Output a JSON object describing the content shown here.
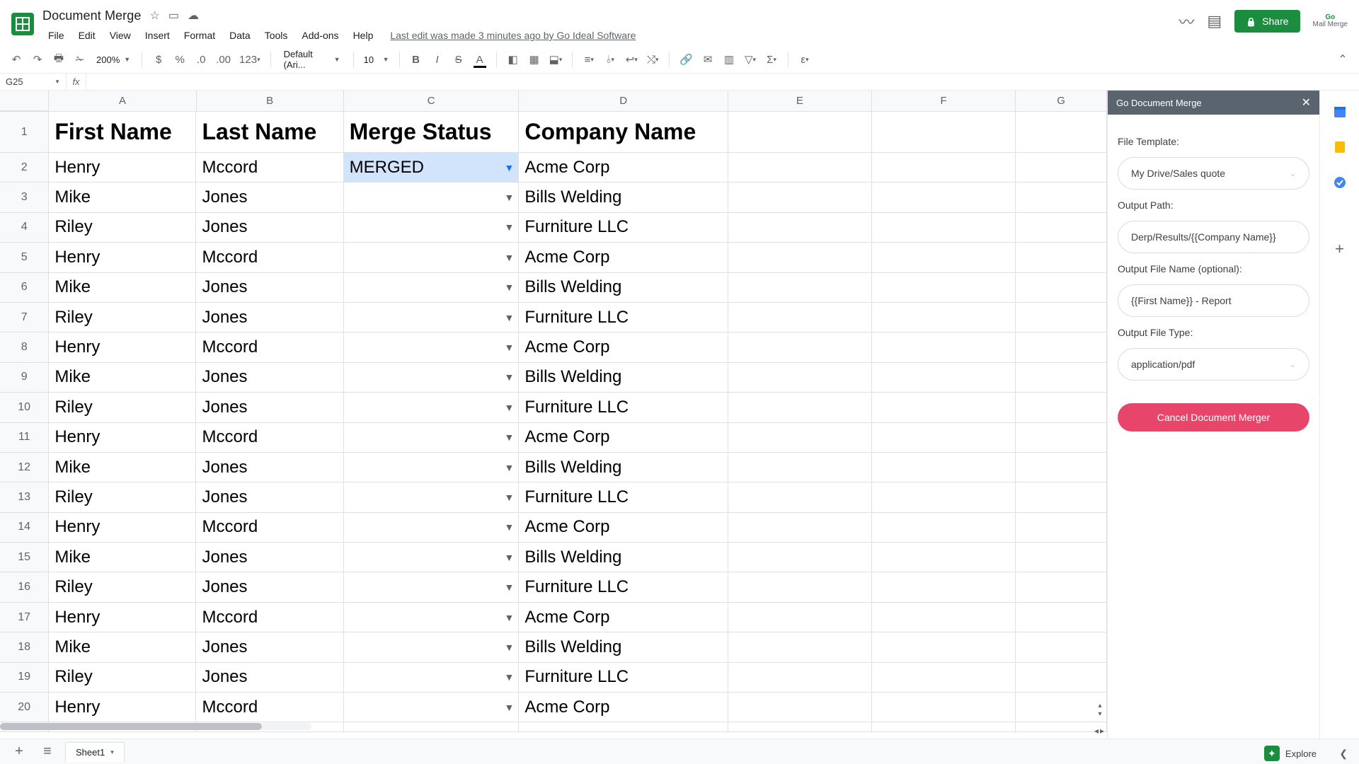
{
  "doc": {
    "title": "Document Merge"
  },
  "menus": [
    "File",
    "Edit",
    "View",
    "Insert",
    "Format",
    "Data",
    "Tools",
    "Add-ons",
    "Help"
  ],
  "last_edit": "Last edit was made 3 minutes ago by Go Ideal Software",
  "share_label": "Share",
  "ext_logo": {
    "top": "Go",
    "bottom": "Mail Merge"
  },
  "toolbar": {
    "zoom": "200%",
    "font_name": "Default (Ari...",
    "font_size": "10",
    "number_fmt": "123"
  },
  "name_box": "G25",
  "columns": [
    "A",
    "B",
    "C",
    "D",
    "E",
    "F",
    "G"
  ],
  "headers": [
    "First Name",
    "Last Name",
    "Merge Status",
    "Company Name",
    "",
    "",
    ""
  ],
  "merged_value": "MERGED",
  "rows": [
    {
      "n": 2,
      "a": "Henry",
      "b": "Mccord",
      "c": "MERGED",
      "d": "Acme Corp",
      "merged": true
    },
    {
      "n": 3,
      "a": "Mike",
      "b": "Jones",
      "c": "",
      "d": "Bills Welding"
    },
    {
      "n": 4,
      "a": "Riley",
      "b": "Jones",
      "c": "",
      "d": "Furniture LLC"
    },
    {
      "n": 5,
      "a": "Henry",
      "b": "Mccord",
      "c": "",
      "d": "Acme Corp"
    },
    {
      "n": 6,
      "a": "Mike",
      "b": "Jones",
      "c": "",
      "d": "Bills Welding"
    },
    {
      "n": 7,
      "a": "Riley",
      "b": "Jones",
      "c": "",
      "d": "Furniture LLC"
    },
    {
      "n": 8,
      "a": "Henry",
      "b": "Mccord",
      "c": "",
      "d": "Acme Corp"
    },
    {
      "n": 9,
      "a": "Mike",
      "b": "Jones",
      "c": "",
      "d": "Bills Welding"
    },
    {
      "n": 10,
      "a": "Riley",
      "b": "Jones",
      "c": "",
      "d": "Furniture LLC"
    },
    {
      "n": 11,
      "a": "Henry",
      "b": "Mccord",
      "c": "",
      "d": "Acme Corp"
    },
    {
      "n": 12,
      "a": "Mike",
      "b": "Jones",
      "c": "",
      "d": "Bills Welding"
    },
    {
      "n": 13,
      "a": "Riley",
      "b": "Jones",
      "c": "",
      "d": "Furniture LLC"
    },
    {
      "n": 14,
      "a": "Henry",
      "b": "Mccord",
      "c": "",
      "d": "Acme Corp"
    },
    {
      "n": 15,
      "a": "Mike",
      "b": "Jones",
      "c": "",
      "d": "Bills Welding"
    },
    {
      "n": 16,
      "a": "Riley",
      "b": "Jones",
      "c": "",
      "d": "Furniture LLC"
    },
    {
      "n": 17,
      "a": "Henry",
      "b": "Mccord",
      "c": "",
      "d": "Acme Corp"
    },
    {
      "n": 18,
      "a": "Mike",
      "b": "Jones",
      "c": "",
      "d": "Bills Welding"
    },
    {
      "n": 19,
      "a": "Riley",
      "b": "Jones",
      "c": "",
      "d": "Furniture LLC"
    },
    {
      "n": 20,
      "a": "Henry",
      "b": "Mccord",
      "c": "",
      "d": "Acme Corp"
    }
  ],
  "side_panel": {
    "title": "Go Document Merge",
    "file_template_label": "File Template:",
    "file_template_value": "My Drive/Sales quote",
    "output_path_label": "Output Path:",
    "output_path_value": "Derp/Results/{{Company Name}}",
    "output_file_name_label": "Output File Name (optional):",
    "output_file_name_value": "{{First Name}} - Report",
    "output_file_type_label": "Output File Type:",
    "output_file_type_value": "application/pdf",
    "cancel_label": "Cancel Document Merger"
  },
  "sheet_tab": "Sheet1",
  "explore_label": "Explore"
}
